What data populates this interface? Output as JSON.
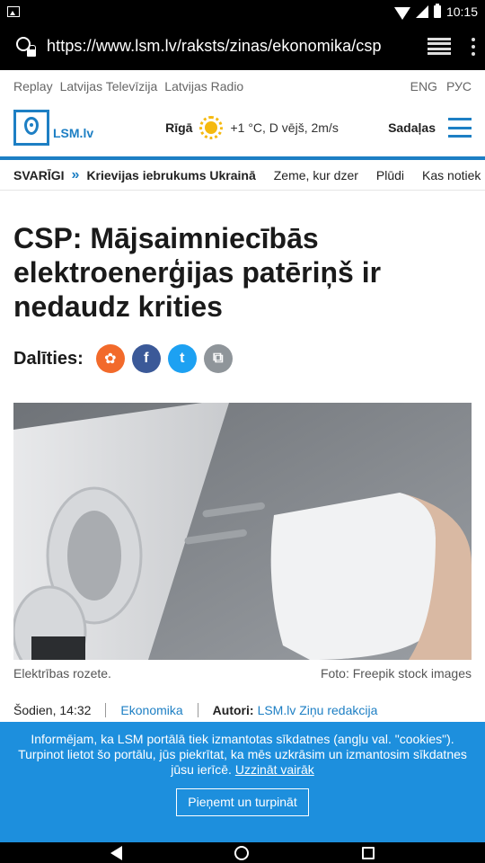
{
  "status_bar": {
    "time": "10:15",
    "icons": [
      "image-icon",
      "wifi-icon",
      "signal-icon",
      "battery-icon"
    ]
  },
  "browser": {
    "url": "https://www.lsm.lv/raksts/zinas/ekonomika/csp",
    "icons": [
      "lock-icon",
      "tabs-icon",
      "menu-icon"
    ]
  },
  "top_nav": {
    "links": [
      "Replay",
      "Latvijas Televīzija",
      "Latvijas Radio"
    ],
    "languages": [
      "ENG",
      "РУС"
    ]
  },
  "header": {
    "logo_text": "LSM.lv",
    "city": "Rīgā",
    "weather": "+1 °C, D vējš, 2m/s",
    "sections_label": "Sadaļas",
    "accent_color": "#1d7fc4"
  },
  "breaking": {
    "label": "SVARĪGI",
    "items": [
      "Krievijas iebrukums Ukrainā",
      "Zeme, kur dzer",
      "Plūdi",
      "Kas notiek"
    ]
  },
  "article": {
    "title": "CSP: Mājsaimniecībās elektroenerģijas patēriņš ir nedaudz krities",
    "share_label": "Dalīties:",
    "share_buttons": [
      {
        "name": "draugiem",
        "glyph": "✿",
        "color": "#f26a2b"
      },
      {
        "name": "facebook",
        "glyph": "f",
        "color": "#3b5998"
      },
      {
        "name": "twitter",
        "glyph": "t",
        "color": "#1da1f2"
      },
      {
        "name": "copy",
        "glyph": "⧉",
        "color": "#8f959a"
      }
    ],
    "image_caption": "Elektrības rozete.",
    "image_credit": "Foto: Freepik stock images",
    "date": "Šodien, 14:32",
    "category": "Ekonomika",
    "author_label": "Autori:",
    "author": "LSM.lv Ziņu redakcija"
  },
  "cookie": {
    "text": "Informējam, ka LSM portālā tiek izmantotas sīkdatnes (angļu val. \"cookies\"). Turpinot lietot šo portālu, jūs piekrītat, ka mēs uzkrāsim un izmantosim sīkdatnes jūsu ierīcē.",
    "more_link": "Uzzināt vairāk",
    "accept_button": "Pieņemt un turpināt",
    "background": "#1d8fdd"
  }
}
